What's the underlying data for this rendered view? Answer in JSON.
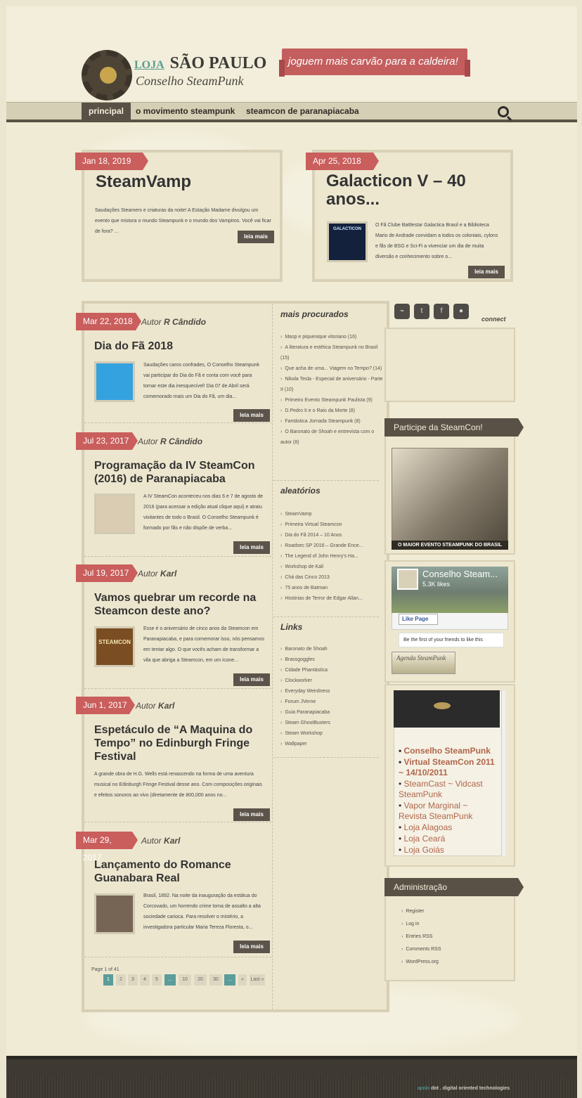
{
  "site": {
    "logo_small": "LOJA",
    "logo_main": "SÃO PAULO",
    "logo_sub": "Conselho SteamPunk",
    "banner": "joguem mais carvão para a caldeira!"
  },
  "nav": {
    "items": [
      {
        "label": "principal",
        "active": true
      },
      {
        "label": "o movimento steampunk",
        "active": false
      },
      {
        "label": "steamcon de paranapiacaba",
        "active": false
      }
    ]
  },
  "features": [
    {
      "date": "Jan 18, 2019",
      "title": "SteamVamp",
      "excerpt": "Saudações Steamers e criaturas da noite! A Estação Madame divulgou um evento que mistura o mundo Steampunk e o mundo dos Vampiros. Você vai ficar de fora? ...",
      "read_more": "leia mais"
    },
    {
      "date": "Apr 25, 2018",
      "title": "Galacticon V – 40 anos...",
      "excerpt": "O Fã Clube Battlestar Galactica Brasil e a Biblioteca Mario de Andrade convidam a todos os coloniais, cylons e fãs de BSG e Sci-Fi a vivenciar um dia de muita diversão e conhecimento sobre o...",
      "read_more": "leia mais",
      "thumb_label": "GALACTICON"
    }
  ],
  "posts": [
    {
      "date": "Mar 22, 2018",
      "author_prefix": "Autor",
      "author": "R Cândido",
      "title": "Dia do Fã 2018",
      "excerpt": "Saudações caros confrades, O Conselho Steampunk vai participar do Dia do Fã e conta com você para tornar este dia inesquecível! Dia 07 de Abril será comemorado mais um Dia do Fã, um dia...",
      "read_more": "leia mais"
    },
    {
      "date": "Jul 23, 2017",
      "author_prefix": "Autor",
      "author": "R Cândido",
      "title": "Programação da IV SteamCon (2016) de Paranapiacaba",
      "excerpt": "A IV SteamCon aconteceu nos dias 6 e 7 de agosto de 2016 (para acessar a edição atual clique aqui) e atraiu visitantes de todo o Brasil. O Conselho Steampunk é formado por fãs e não dispõe de verba...",
      "read_more": "leia mais"
    },
    {
      "date": "Jul 19, 2017",
      "author_prefix": "Autor",
      "author": "Karl",
      "title": "Vamos quebrar um recorde na Steamcon deste ano?",
      "excerpt": "Esse é o aniversário de cinco anos da Steamcon em Paranapiacaba, e para comemorar isso, nós pensamos em tentar algo. O que vocês acham de transformar a vila que abriga a Steamcon, em um ícone...",
      "read_more": "leia mais",
      "thumb_label": "STEAMCON"
    },
    {
      "date": "Jun 1, 2017",
      "author_prefix": "Autor",
      "author": "Karl",
      "title": "Espetáculo de “A Maquina do Tempo” no Edinburgh Fringe Festival",
      "excerpt": "A grande obra de H.G. Wells está renascendo na forma de uma aventura musical no Edinburgh Fringe Festival desse ano. Com composições originais e efeitos sonoros ao vivo (diretamente de 800,000 anos no...",
      "read_more": "leia mais"
    },
    {
      "date": "Mar 29, 2017",
      "author_prefix": "Autor",
      "author": "Karl",
      "title": "Lançamento do Romance Guanabara Real",
      "excerpt": "Brasil, 1892. Na noite da inauguração da estátua do Corcovado, um horrendo crime toma de assalto a alta sociedade carioca. Para resolver o mistério, a investigadora particular Maria Tereza Floresta, o...",
      "read_more": "leia mais"
    }
  ],
  "pagination": {
    "label": "Page 1 of 41",
    "items": [
      "1",
      "2",
      "3",
      "4",
      "5",
      "...",
      "10",
      "20",
      "30",
      "...",
      "»",
      "Last »"
    ]
  },
  "middle": {
    "most_searched_title": "mais procurados",
    "most_searched": [
      "Masp e piquenique vitoriano (16)",
      "A literatura e estética Steampunk no Brasil (15)",
      "Que acha de uma... Viagem no Tempo? (14)",
      "Nikola Tesla - Especial de aniversário - Parte II (10)",
      "Primeiro Evento Steampunk Paulista (9)",
      "D.Pedro II e o Raio da Morte (8)",
      "Fantástica Jornada Steampunk (8)",
      "O Baronato de Shoah e entrevista com o autor (8)"
    ],
    "random_title": "aleatórios",
    "random": [
      "SteamVamp",
      "Primeira Virtual Steamcon",
      "Dia do Fã 2014 – 10 Anos",
      "Roadsec SP 2016 – Grande Ence...",
      "The Legend of John Henry's Ha...",
      "Workshop de Kali",
      "Chá das Cinco 2013",
      "75 anos de Batman",
      "Histórias de Terror de Edgar Allan..."
    ],
    "links_title": "Links",
    "links": [
      "Baronato de Shoah",
      "Brassgoggles",
      "Cidade Phantástica",
      "Clockworker",
      "Everyday Weirdness",
      "Forum JVerne",
      "Guia Paranapiacaba",
      "Steam GhostBusters",
      "Steam Workshop",
      "Wallpaper"
    ]
  },
  "sidebar": {
    "connect": "connect",
    "social_icons": [
      "rss-icon",
      "twitter-icon",
      "facebook-icon",
      "flickr-icon"
    ],
    "steamcon_title": "Participe da SteamCon!",
    "steamcon_footer": "O MAIOR EVENTO STEAMPUNK DO BRASIL",
    "fb_name": "Conselho Steam...",
    "fb_likes": "5.3K likes",
    "fb_button": "Like Page",
    "fb_friends": "Be the first of your friends to like this",
    "agenda": "Agenda SteamPunk",
    "embed_links": [
      "Conselho SteamPunk",
      "Virtual SteamCon 2011 ~ 14/10/2011",
      "SteamCast ~ Vidcast SteamPunk",
      "Vapor Marginal ~ Revista SteamPunk",
      "Loja Alagoas",
      "Loja Ceará",
      "Loja Goiás"
    ],
    "admin_title": "Administração",
    "admin_links": [
      "Register",
      "Log in",
      "Entries RSS",
      "Comments RSS",
      "WordPress.org"
    ]
  },
  "footer": {
    "brand": "apolo",
    "text": "dot . digital oriented technologies"
  },
  "colors": {
    "accent_red": "#c95e5c",
    "dark_brown": "#5a5146",
    "teal": "#5a9d9a"
  }
}
